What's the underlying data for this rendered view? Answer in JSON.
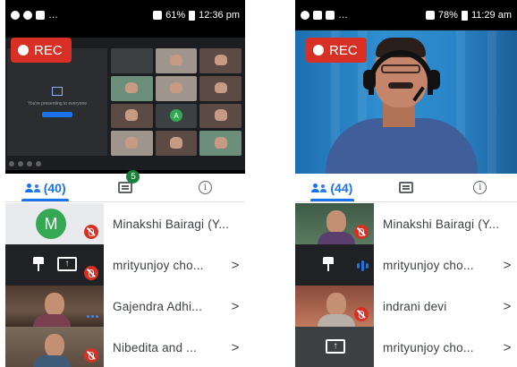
{
  "left": {
    "status": {
      "battery": "61%",
      "time": "12:36 pm"
    },
    "rec_label": "REC",
    "shared_screen": {
      "presenting_text": "You're presenting to everyone",
      "tile_avatar": "A"
    },
    "tabs": {
      "people_count": "(40)",
      "chat_badge": "5"
    },
    "participants": [
      {
        "name": "Minakshi Bairagi (Y...",
        "avatar_letter": "M"
      },
      {
        "name": "mrityunjoy cho..."
      },
      {
        "name": "Gajendra Adhi..."
      },
      {
        "name": "Nibedita and ..."
      }
    ]
  },
  "right": {
    "status": {
      "battery": "78%",
      "time": "11:29 am"
    },
    "rec_label": "REC",
    "tabs": {
      "people_count": "(44)"
    },
    "participants": [
      {
        "name": "Minakshi Bairagi (Y..."
      },
      {
        "name": "mrityunjoy cho..."
      },
      {
        "name": "indrani devi"
      },
      {
        "name": "mrityunjoy cho..."
      }
    ]
  },
  "chevron_glyph": ">",
  "info_glyph": "i",
  "colors": {
    "accent": "#1a73e8",
    "rec": "#d93025",
    "avatar": "#34a853",
    "badge": "#188038"
  }
}
